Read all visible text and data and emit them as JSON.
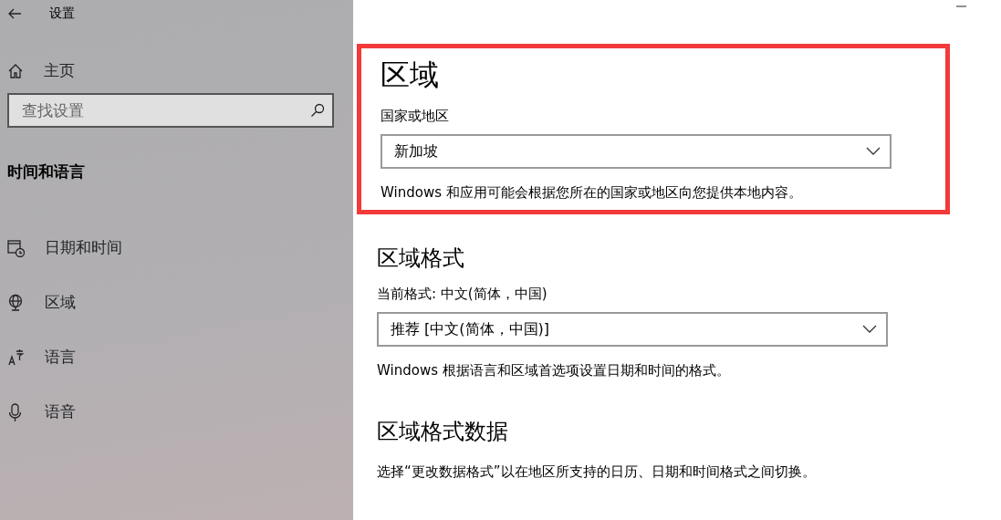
{
  "window": {
    "title": "设置"
  },
  "sidebar": {
    "home": "主页",
    "search": {
      "placeholder": "查找设置"
    },
    "category": "时间和语言",
    "items": [
      {
        "kind": "calendar",
        "label": "日期和时间"
      },
      {
        "kind": "globe",
        "label": "区域"
      },
      {
        "kind": "language",
        "label": "语言"
      },
      {
        "kind": "microphone",
        "label": "语音"
      }
    ]
  },
  "sections": [
    {
      "title": "区域",
      "highlighted": true,
      "field_label": "国家或地区",
      "dropdown": "新加坡",
      "description": "Windows 和应用可能会根据您所在的国家或地区向您提供本地内容。"
    },
    {
      "title": "区域格式",
      "highlighted": false,
      "field_label": "当前格式: 中文(简体，中国)",
      "dropdown": "推荐 [中文(简体，中国)]",
      "description": "Windows 根据语言和区域首选项设置日期和时间的格式。"
    },
    {
      "title": "区域格式数据",
      "highlighted": false,
      "description": "选择“更改数据格式”以在地区所支持的日历、日期和时间格式之间切换。"
    }
  ]
}
